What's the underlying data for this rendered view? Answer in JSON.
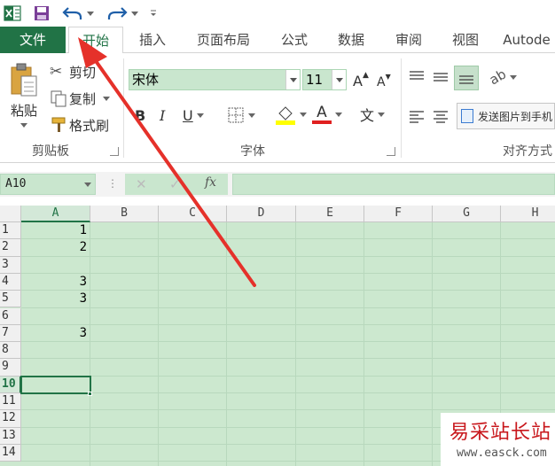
{
  "qat": {
    "excel_icon": "excel-logo-icon",
    "save_icon": "save-icon",
    "undo_icon": "undo-icon",
    "redo_icon": "redo-icon",
    "customize_icon": "customize-qat-icon"
  },
  "tabs": [
    {
      "label": "文件"
    },
    {
      "label": "开始"
    },
    {
      "label": "插入"
    },
    {
      "label": "页面布局"
    },
    {
      "label": "公式"
    },
    {
      "label": "数据"
    },
    {
      "label": "审阅"
    },
    {
      "label": "视图"
    },
    {
      "label": "Autode"
    }
  ],
  "ribbon": {
    "clipboard": {
      "paste_label": "粘贴",
      "cut_label": "剪切",
      "copy_label": "复制",
      "format_painter_label": "格式刷",
      "group_label": "剪贴板"
    },
    "font": {
      "font_name": "宋体",
      "font_size": "11",
      "bold": "B",
      "italic": "I",
      "underline": "U",
      "font_color_letter": "A",
      "highlight_color": "#ffff00",
      "font_color": "#e02020",
      "phonetic_label": "文",
      "grow_font": "A",
      "shrink_font": "A",
      "group_label": "字体"
    },
    "alignment": {
      "send_image_label": "发送图片到手机",
      "group_label": "对齐方式"
    }
  },
  "formula_bar": {
    "name_box": "A10",
    "fx_label": "fx",
    "formula": ""
  },
  "sheet": {
    "columns": [
      "A",
      "B",
      "C",
      "D",
      "E",
      "F",
      "G",
      "H"
    ],
    "rows": [
      "1",
      "2",
      "3",
      "4",
      "5",
      "6",
      "7",
      "8",
      "9",
      "10",
      "11",
      "12",
      "13",
      "14"
    ],
    "col_a_values": [
      "1",
      "2",
      "",
      "3",
      "3",
      "",
      "3",
      "",
      "",
      "",
      "",
      "",
      "",
      ""
    ],
    "selected_cell": "A10"
  },
  "watermark": {
    "title": "易采站长站",
    "url": "www.easck.com"
  },
  "colors": {
    "excel_green": "#217346",
    "grid_green": "#cce8cf",
    "arrow_red": "#e5312a"
  }
}
